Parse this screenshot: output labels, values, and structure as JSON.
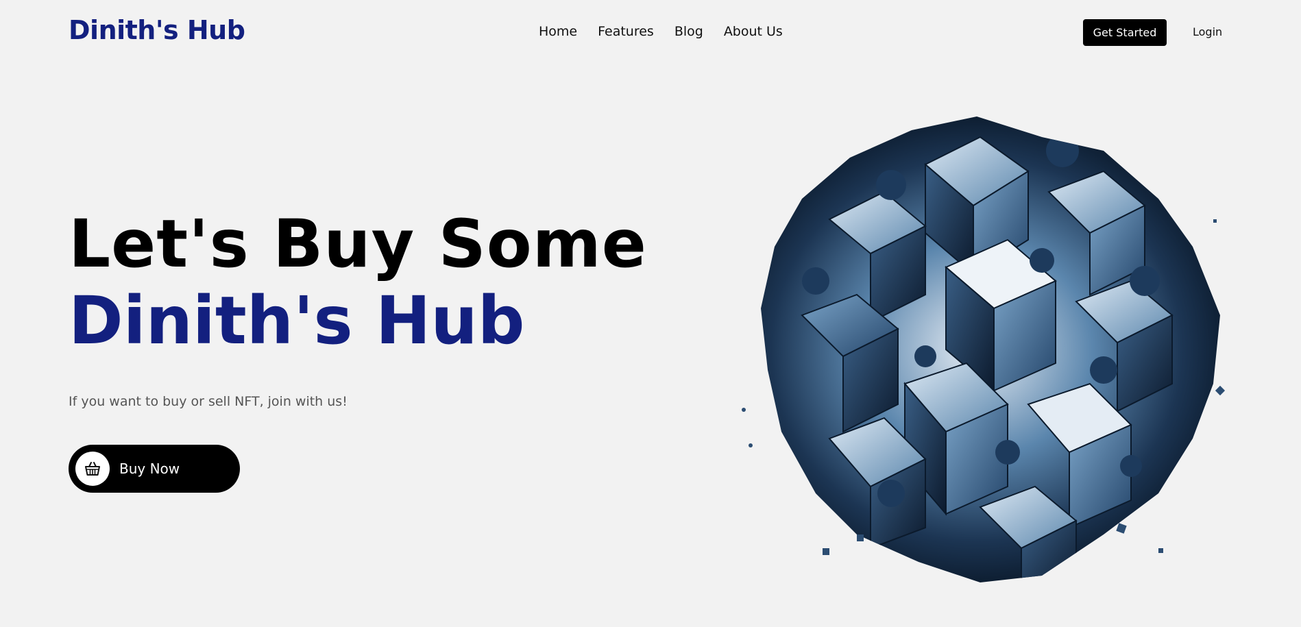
{
  "header": {
    "brand": "Dinith's Hub",
    "nav": [
      "Home",
      "Features",
      "Blog",
      "About Us"
    ],
    "get_started_label": "Get Started",
    "login_label": "Login"
  },
  "hero": {
    "line1": "Let's Buy Some",
    "line2": "Dinith's Hub",
    "subtext": "If you want to buy or sell NFT, join with us!",
    "buy_label": "Buy Now",
    "buy_icon": "basket-icon",
    "artwork": "nft-cube-sphere-image"
  },
  "colors": {
    "brand": "#13207f",
    "background": "#f2f2f2",
    "button": "#000000"
  }
}
